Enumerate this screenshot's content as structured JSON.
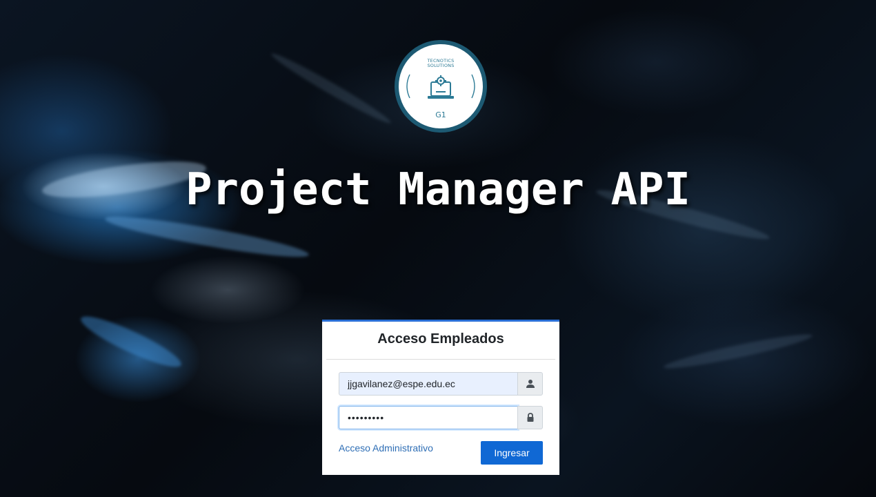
{
  "logo": {
    "line1": "TECNOTICS",
    "line2": "SOLUTIONS",
    "label": "G1",
    "icon": "laptop-gear-icon",
    "ring_color": "#1d5a73"
  },
  "page": {
    "title": "Project Manager API"
  },
  "login": {
    "title": "Acceso Empleados",
    "email_value": "jjgavilanez@espe.edu.ec",
    "email_icon": "user-icon",
    "password_value": "•••••••••",
    "password_icon": "lock-icon",
    "admin_link": "Acceso Administrativo",
    "submit_label": "Ingresar",
    "accent_color": "#1068d4"
  }
}
